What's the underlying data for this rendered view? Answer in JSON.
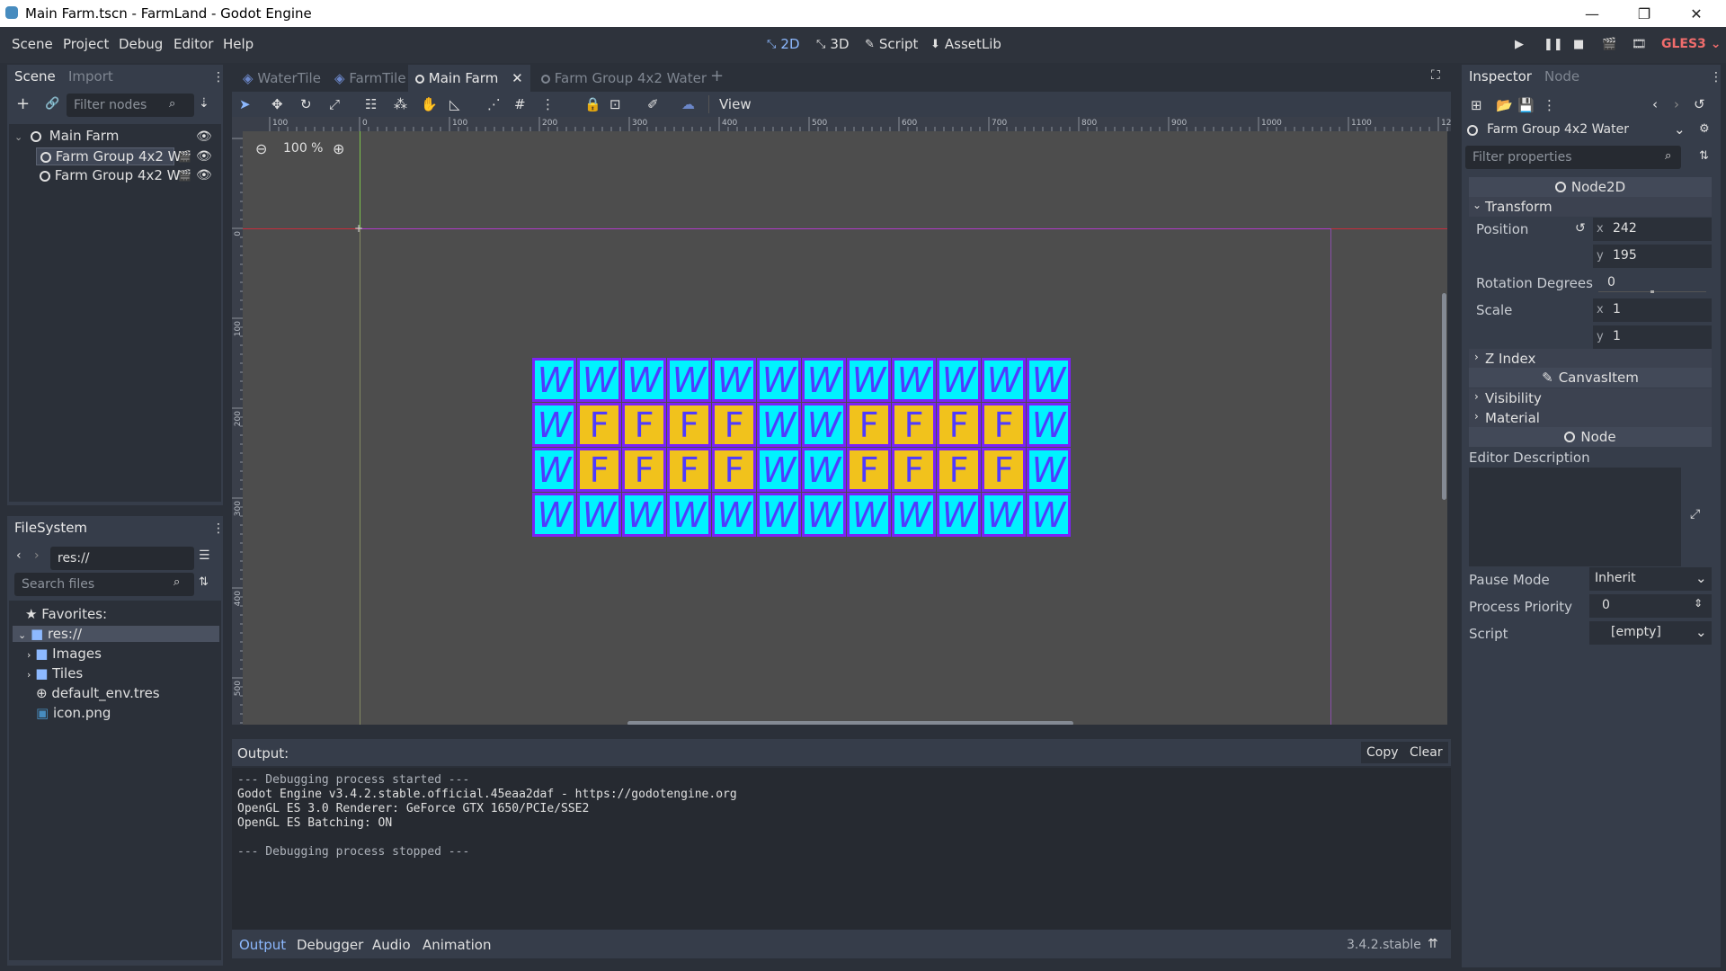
{
  "window": {
    "title": "Main Farm.tscn - FarmLand - Godot Engine",
    "minimize": "—",
    "maximize": "❐",
    "close": "✕"
  },
  "menu": [
    "Scene",
    "Project",
    "Debug",
    "Editor",
    "Help"
  ],
  "workspaces": {
    "w2d": "2D",
    "w3d": "3D",
    "script": "Script",
    "assetlib": "AssetLib"
  },
  "renderer": "GLES3",
  "scene_dock": {
    "tabs": [
      "Scene",
      "Import"
    ],
    "filter_placeholder": "Filter nodes",
    "tree": [
      {
        "label": "Main Farm"
      },
      {
        "label": "Farm Group 4x2 W"
      },
      {
        "label": "Farm Group 4x2 W"
      }
    ]
  },
  "filesystem": {
    "title": "FileSystem",
    "path": "res://",
    "search_placeholder": "Search files",
    "items": [
      {
        "label": "Favorites:"
      },
      {
        "label": "res://"
      },
      {
        "label": "Images"
      },
      {
        "label": "Tiles"
      },
      {
        "label": "default_env.tres"
      },
      {
        "label": "icon.png"
      }
    ]
  },
  "editor_tabs": [
    "WaterTile",
    "FarmTile",
    "Main Farm",
    "Farm Group 4x2 Water"
  ],
  "toolbar": {
    "view": "View"
  },
  "viewport": {
    "zoom": "100 %",
    "ruler_top": [
      "100",
      "0",
      "100",
      "200",
      "300",
      "400",
      "500",
      "600",
      "700",
      "800",
      "900",
      "1000",
      "1100",
      "12"
    ],
    "ruler_left": [
      "0",
      "100",
      "200",
      "300",
      "400",
      "500"
    ],
    "tile_rows": [
      "WWWWWWWWWWWW",
      "WFFFFWWFFFFW",
      "WFFFFWWFFFFW",
      "WWWWWWWWWWWW"
    ],
    "tile_letters": {
      "W": "W",
      "F": "F"
    },
    "tile_colors": {
      "W": "#00f2ff",
      "F": "#f1c21c",
      "border": "#7b22f7",
      "letter": "#4f3bff"
    }
  },
  "output": {
    "title": "Output:",
    "copy": "Copy",
    "clear": "Clear",
    "lines": [
      "--- Debugging process started ---",
      "Godot Engine v3.4.2.stable.official.45eaa2daf - https://godotengine.org",
      "OpenGL ES 3.0 Renderer: GeForce GTX 1650/PCIe/SSE2",
      "OpenGL ES Batching: ON",
      "",
      "--- Debugging process stopped ---"
    ],
    "bottom_tabs": [
      "Output",
      "Debugger",
      "Audio",
      "Animation"
    ],
    "version": "3.4.2.stable"
  },
  "inspector": {
    "tabs": [
      "Inspector",
      "Node"
    ],
    "object": "Farm Group 4x2 Water",
    "filter_placeholder": "Filter properties",
    "class_node2d": "Node2D",
    "transform": "Transform",
    "position_label": "Position",
    "pos_x": "242",
    "pos_y": "195",
    "rotation_label": "Rotation Degrees",
    "rotation": "0",
    "scale_label": "Scale",
    "scale_x": "1",
    "scale_y": "1",
    "z_index": "Z Index",
    "class_canvasitem": "CanvasItem",
    "visibility": "Visibility",
    "material": "Material",
    "class_node": "Node",
    "editor_description": "Editor Description",
    "pause_mode_label": "Pause Mode",
    "pause_mode": "Inherit",
    "process_priority_label": "Process Priority",
    "process_priority": "0",
    "script_label": "Script",
    "script": "[empty]",
    "x": "x",
    "y": "y"
  }
}
